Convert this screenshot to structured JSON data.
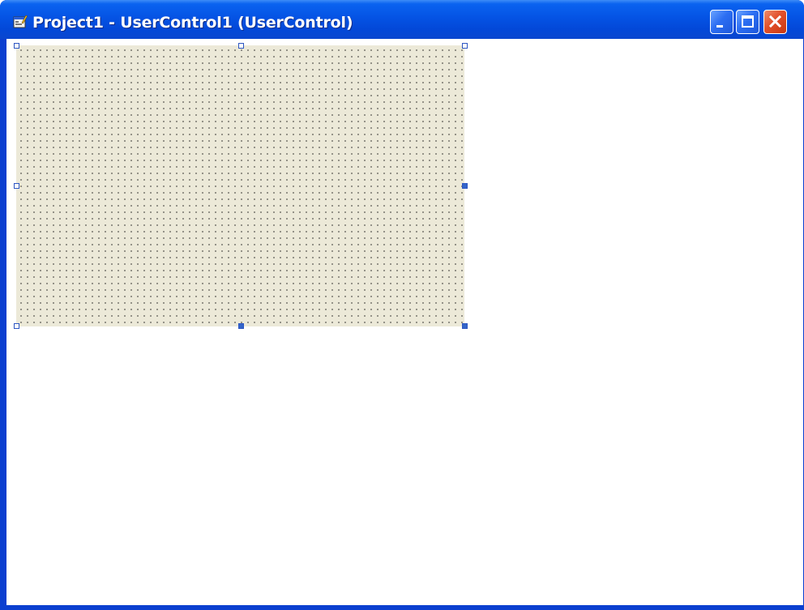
{
  "window": {
    "title": "Project1 - UserControl1 (UserControl)",
    "app_icon": "form-designer-icon",
    "title_bar_color": "#0553e4"
  },
  "caption_buttons": {
    "minimize_icon": "minimize-icon",
    "maximize_icon": "maximize-icon",
    "close_icon": "close-icon",
    "close_color": "#e2502a"
  },
  "designer": {
    "surface_color": "#ece9d8",
    "grid_dot_color": "#202020",
    "handle_color": "#3465c9"
  }
}
